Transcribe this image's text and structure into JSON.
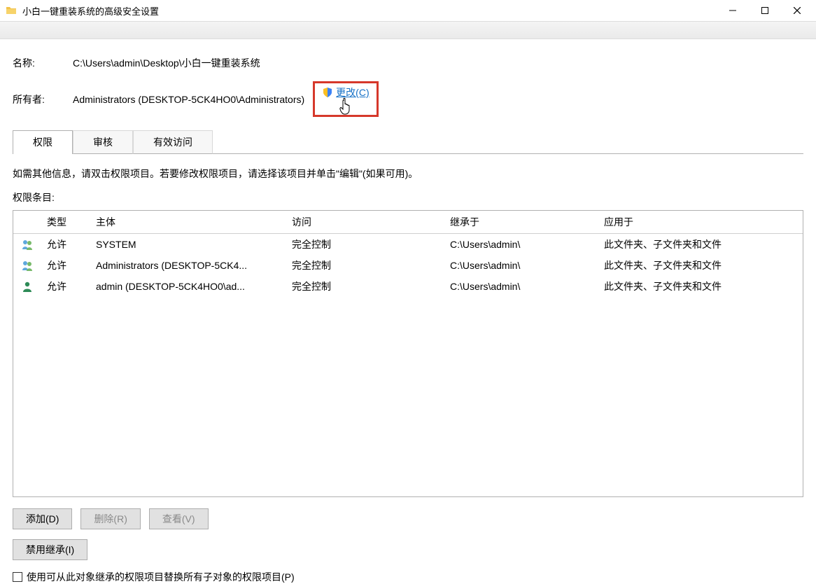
{
  "window": {
    "title": "小白一键重装系统的高级安全设置"
  },
  "header": {
    "name_label": "名称:",
    "name_value": "C:\\Users\\admin\\Desktop\\小白一键重装系统",
    "owner_label": "所有者:",
    "owner_value": "Administrators (DESKTOP-5CK4HO0\\Administrators)",
    "change_link": "更改(C)"
  },
  "tabs": {
    "permissions": "权限",
    "audit": "审核",
    "effective": "有效访问"
  },
  "body": {
    "hint": "如需其他信息，请双击权限项目。若要修改权限项目，请选择该项目并单击\"编辑\"(如果可用)。",
    "entries_label": "权限条目:"
  },
  "columns": {
    "type": "类型",
    "principal": "主体",
    "access": "访问",
    "inherited_from": "继承于",
    "applies_to": "应用于"
  },
  "rows": [
    {
      "icon": "group",
      "type": "允许",
      "principal": "SYSTEM",
      "access": "完全控制",
      "inherited": "C:\\Users\\admin\\",
      "applies": "此文件夹、子文件夹和文件"
    },
    {
      "icon": "group",
      "type": "允许",
      "principal": "Administrators (DESKTOP-5CK4...",
      "access": "完全控制",
      "inherited": "C:\\Users\\admin\\",
      "applies": "此文件夹、子文件夹和文件"
    },
    {
      "icon": "user",
      "type": "允许",
      "principal": "admin (DESKTOP-5CK4HO0\\ad...",
      "access": "完全控制",
      "inherited": "C:\\Users\\admin\\",
      "applies": "此文件夹、子文件夹和文件"
    }
  ],
  "buttons": {
    "add": "添加(D)",
    "remove": "删除(R)",
    "view": "查看(V)",
    "disable_inherit": "禁用继承(I)"
  },
  "checkbox": {
    "replace_label": "使用可从此对象继承的权限项目替换所有子对象的权限项目(P)"
  }
}
